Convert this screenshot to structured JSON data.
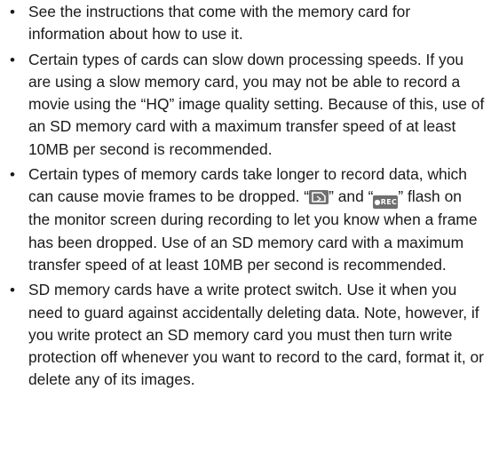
{
  "document": {
    "items": [
      {
        "text": "See the instructions that come with the memory card for information about how to use it."
      },
      {
        "text": "Certain types of cards can slow down processing speeds. If you are using a slow memory card, you may not be able to record a movie using the “HQ” image quality setting. Because of this, use of an SD memory card with a maximum transfer speed of at least 10MB per second is recommended."
      },
      {
        "text_before": "Certain types of memory cards take longer to record data, which can cause movie frames to be dropped. “",
        "text_between_1": "” and “",
        "text_after": "” flash on the monitor screen during recording to let you know when a frame has been dropped. Use of an SD memory card with a maximum transfer speed of at least 10MB per second is recommended.",
        "icon_1": "memory-card-icon",
        "icon_2": "rec-indicator-icon",
        "icon_2_label": "●REC"
      },
      {
        "text": "SD memory cards have a write protect switch. Use it when you need to guard against accidentally deleting data. Note, however, if you write protect an SD memory card you must then turn write protection off whenever you want to record to the card, format it, or delete any of its images."
      }
    ],
    "bullet": "•"
  },
  "colors": {
    "text": "#1a1a1a",
    "icon_background": "#6f6f6f",
    "icon_foreground": "#ffffff"
  }
}
